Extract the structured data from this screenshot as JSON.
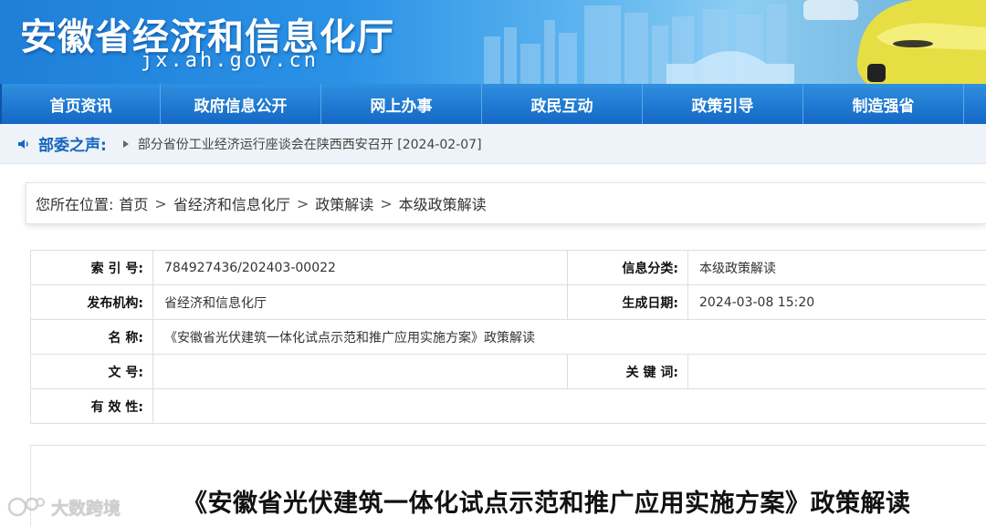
{
  "header": {
    "site_title": "安徽省经济和信息化厅",
    "site_domain": "jx.ah.gov.cn"
  },
  "nav": {
    "items": [
      {
        "label": "首页资讯"
      },
      {
        "label": "政府信息公开"
      },
      {
        "label": "网上办事"
      },
      {
        "label": "政民互动"
      },
      {
        "label": "政策引导"
      },
      {
        "label": "制造强省"
      }
    ]
  },
  "notice": {
    "label": "部委之声:",
    "text": "部分省份工业经济运行座谈会在陕西西安召开 [2024-02-07]"
  },
  "breadcrumb": {
    "prefix": "您所在位置:",
    "items": [
      "首页",
      "省经济和信息化厅",
      "政策解读",
      "本级政策解读"
    ],
    "separator": ">"
  },
  "info": {
    "index_label": "索 引 号:",
    "index_value": "784927436/202403-00022",
    "category_label": "信息分类:",
    "category_value": "本级政策解读",
    "publisher_label": "发布机构:",
    "publisher_value": "省经济和信息化厅",
    "date_label": "生成日期:",
    "date_value": "2024-03-08 15:20",
    "name_label": "名 称:",
    "name_value": "《安徽省光伏建筑一体化试点示范和推广应用实施方案》政策解读",
    "docno_label": "文 号:",
    "docno_value": "",
    "keywords_label": "关 键 词:",
    "keywords_value": "",
    "validity_label": "有 效 性:",
    "validity_value": ""
  },
  "article": {
    "title": "《安徽省光伏建筑一体化试点示范和推广应用实施方案》政策解读"
  },
  "watermark": {
    "text": "大数跨境"
  },
  "colors": {
    "brand_blue": "#1468c4",
    "notice_label": "#1465c0"
  },
  "icons": {
    "notice": "speaker-icon",
    "notice_item": "arrow-right-icon",
    "watermark": "logo-mark-icon"
  }
}
